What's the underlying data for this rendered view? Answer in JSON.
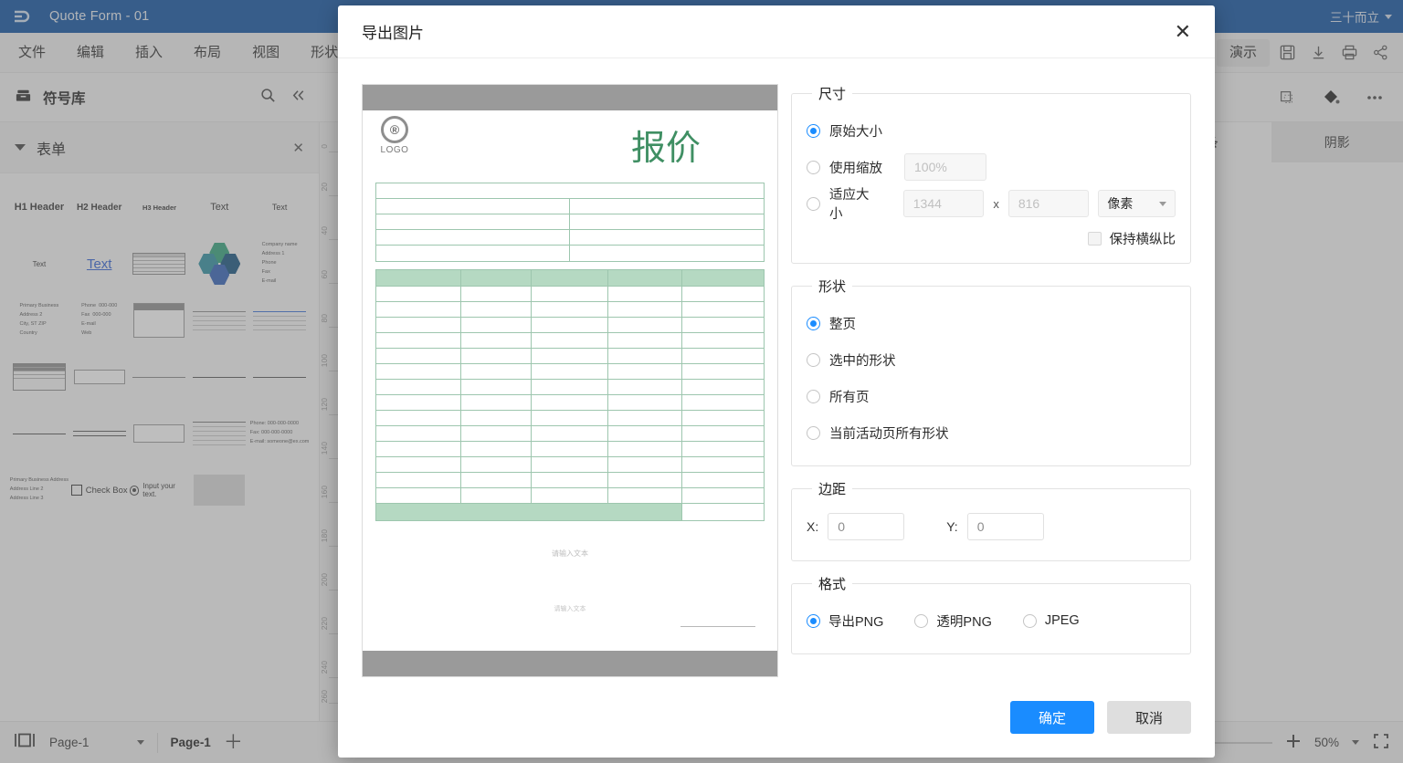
{
  "titlebar": {
    "app_icon": "brand-logo-icon",
    "doc_title": "Quote Form - 01",
    "user_name": "三十而立"
  },
  "menubar": {
    "items": [
      "文件",
      "编辑",
      "插入",
      "布局",
      "视图",
      "形状"
    ],
    "present_label": "演示",
    "icons": [
      "save-icon",
      "download-icon",
      "print-icon",
      "share-icon"
    ]
  },
  "library": {
    "title": "符号库",
    "icons": [
      "library-icon",
      "search-icon",
      "collapse-icon"
    ],
    "group_title": "表单",
    "tiles": [
      "H1 Header",
      "H2 Header",
      "H3 Header",
      "Text",
      "Text",
      "Text",
      "Text",
      "table-thumb",
      "flower-shape-thumb",
      "company-info-thumb"
    ],
    "checkbox_label": "Check Box",
    "input_label": "Input your text."
  },
  "toolbar2": {
    "icons": [
      "group-icon",
      "fill-color-icon",
      "more-icon"
    ]
  },
  "right_panel": {
    "tabs": [
      {
        "label": "线条",
        "active": true
      },
      {
        "label": "阴影",
        "active": false
      }
    ]
  },
  "ruler": {
    "ticks": [
      "0",
      "20",
      "40",
      "60",
      "80",
      "100",
      "120",
      "140",
      "160",
      "180",
      "200",
      "220",
      "240",
      "260"
    ]
  },
  "statusbar": {
    "page_select": "Page-1",
    "page_tab": "Page-1",
    "add_page_icon": "plus-icon",
    "zoom_out_icon": "minus-icon",
    "zoom_in_icon": "plus-icon",
    "zoom_level": "50%",
    "fullscreen_icon": "fullscreen-icon",
    "layout_icon": "page-layout-icon"
  },
  "dialog": {
    "title": "导出图片",
    "close_icon": "close-icon",
    "preview": {
      "logo_mark": "®",
      "logo_text": "LOGO",
      "heading": "报价",
      "placeholder_1": "请输入文本",
      "placeholder_2": "请输入文本"
    },
    "size": {
      "legend": "尺寸",
      "options": [
        {
          "label": "原始大小",
          "selected": true
        },
        {
          "label": "使用缩放",
          "selected": false
        },
        {
          "label": "适应大小",
          "selected": false
        }
      ],
      "scale_placeholder": "100%",
      "width_placeholder": "1344",
      "height_placeholder": "816",
      "x_separator": "x",
      "unit_value": "像素",
      "keep_ratio_label": "保持横纵比",
      "keep_ratio_checked": false
    },
    "shape": {
      "legend": "形状",
      "options": [
        {
          "label": "整页",
          "selected": true
        },
        {
          "label": "选中的形状",
          "selected": false
        },
        {
          "label": "所有页",
          "selected": false
        },
        {
          "label": "当前活动页所有形状",
          "selected": false
        }
      ]
    },
    "margin": {
      "legend": "边距",
      "x_label": "X:",
      "x_value": "0",
      "y_label": "Y:",
      "y_value": "0"
    },
    "format": {
      "legend": "格式",
      "options": [
        {
          "label": "导出PNG",
          "selected": true
        },
        {
          "label": "透明PNG",
          "selected": false
        },
        {
          "label": "JPEG",
          "selected": false
        }
      ]
    },
    "confirm_label": "确定",
    "cancel_label": "取消"
  },
  "colors": {
    "titlebar": "#0a4fa0",
    "accent": "#1a8cff",
    "preview_heading": "#3f8f63",
    "table_green": "#b5d9c2",
    "table_border": "#9dc6ae"
  }
}
